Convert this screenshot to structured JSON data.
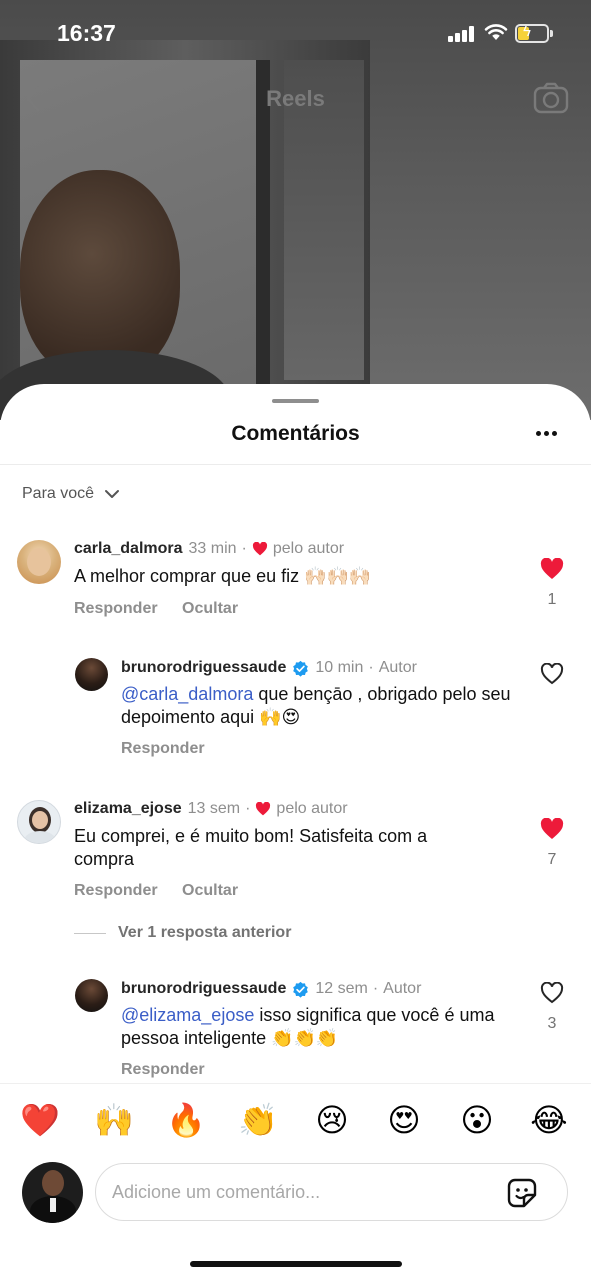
{
  "status_bar": {
    "time": "16:37"
  },
  "reels_header": {
    "title": "Reels"
  },
  "sheet": {
    "title": "Comentários",
    "filter_label": "Para você"
  },
  "comments": [
    {
      "username": "carla_dalmora",
      "time": "33 min",
      "liked_by_author": "pelo autor",
      "text": "A melhor comprar que eu fiz 🙌🏻🙌🏻🙌🏻",
      "reply_label": "Responder",
      "hide_label": "Ocultar",
      "liked": true,
      "likes": "1"
    },
    {
      "username": "brunorodriguessaude",
      "time": "10 min",
      "author_badge": "Autor",
      "mention": "@carla_dalmora",
      "text": " que bençāo , obrigado pelo seu depoimento aqui 🙌😍",
      "reply_label": "Responder",
      "liked": false
    },
    {
      "username": "elizama_ejose",
      "time": "13 sem",
      "liked_by_author": "pelo autor",
      "text": "Eu comprei, e é muito bom! Satisfeita com a compra",
      "reply_label": "Responder",
      "hide_label": "Ocultar",
      "liked": true,
      "likes": "7"
    },
    {
      "username": "brunorodriguessaude",
      "time": "12 sem",
      "author_badge": "Autor",
      "mention": "@elizama_ejose",
      "text": " isso significa que você é uma pessoa inteligente 👏👏👏",
      "reply_label": "Responder",
      "liked": false,
      "likes": "3"
    }
  ],
  "more_replies": "Ver 1 resposta anterior",
  "emoji_bar": [
    "❤️",
    "🙌",
    "🔥",
    "👏",
    "😢",
    "😍",
    "😮",
    "😂"
  ],
  "compose": {
    "placeholder": "Adicione um comentário..."
  },
  "colors": {
    "heart": "#ed1a3a",
    "mention": "#3b5ec7",
    "verified": "#1d9bf0"
  }
}
